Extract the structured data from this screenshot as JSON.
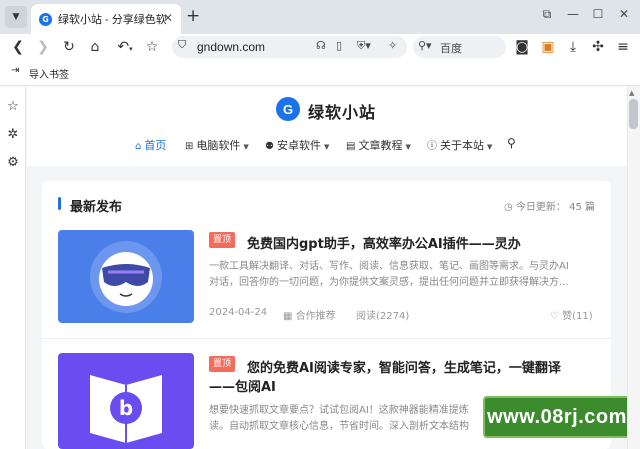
{
  "browser": {
    "tab_favicon": "G",
    "tab_title": "绿软小站 - 分享绿色软",
    "tab_close": "✕",
    "new_tab": "+",
    "window_controls": [
      "⧉",
      "—",
      "☐",
      "✕"
    ],
    "address": "gndown.com",
    "search_placeholder": "百度",
    "bookmark_bar_item": "导入书签"
  },
  "site": {
    "logo_letter": "G",
    "name": "绿软小站",
    "nav": [
      {
        "label": "首页",
        "icon": "home-icon",
        "active": true
      },
      {
        "label": "电脑软件",
        "icon": "windows-icon",
        "dropdown": true
      },
      {
        "label": "安卓软件",
        "icon": "android-icon",
        "dropdown": true
      },
      {
        "label": "文章教程",
        "icon": "document-icon",
        "dropdown": true
      },
      {
        "label": "关于本站",
        "icon": "info-icon",
        "dropdown": true
      }
    ]
  },
  "section": {
    "title": "最新发布",
    "today_label": "今日更新：",
    "today_count": "45",
    "today_unit": "篇"
  },
  "posts": [
    {
      "tag": "置顶",
      "title": "免费国内gpt助手，高效率办公AI插件——灵办",
      "excerpt_1": "一款工具解决翻译、对话、写作、阅读、信息获取、笔记、画图等需求。与灵办AI",
      "excerpt_2": "对话，回答你的一切问题，为你提供文案灵感，提出任何问题并立即获得解决方...",
      "date": "2024-04-24",
      "category": "合作推荐",
      "views": "阅读(2274)",
      "likes": "赞(11)",
      "thumb_color": "#4a7ee8"
    },
    {
      "tag": "置顶",
      "title_1": "您的免费AI阅读专家，智能问答，生成笔记，一键翻译",
      "title_2": "——包阅AI",
      "excerpt_1": "想要快速抓取文章要点？试试包阅AI！这款神器能精准提炼",
      "excerpt_2": "读。自动抓取文章核心信息，节省时间。深入剖析文本结构",
      "thumb_color": "#6a4df0"
    }
  ],
  "watermark": "www.08rj.com",
  "colors": {
    "accent": "#1a73e8",
    "tag": "#f36b5b",
    "watermark": "#3c8b2c"
  }
}
